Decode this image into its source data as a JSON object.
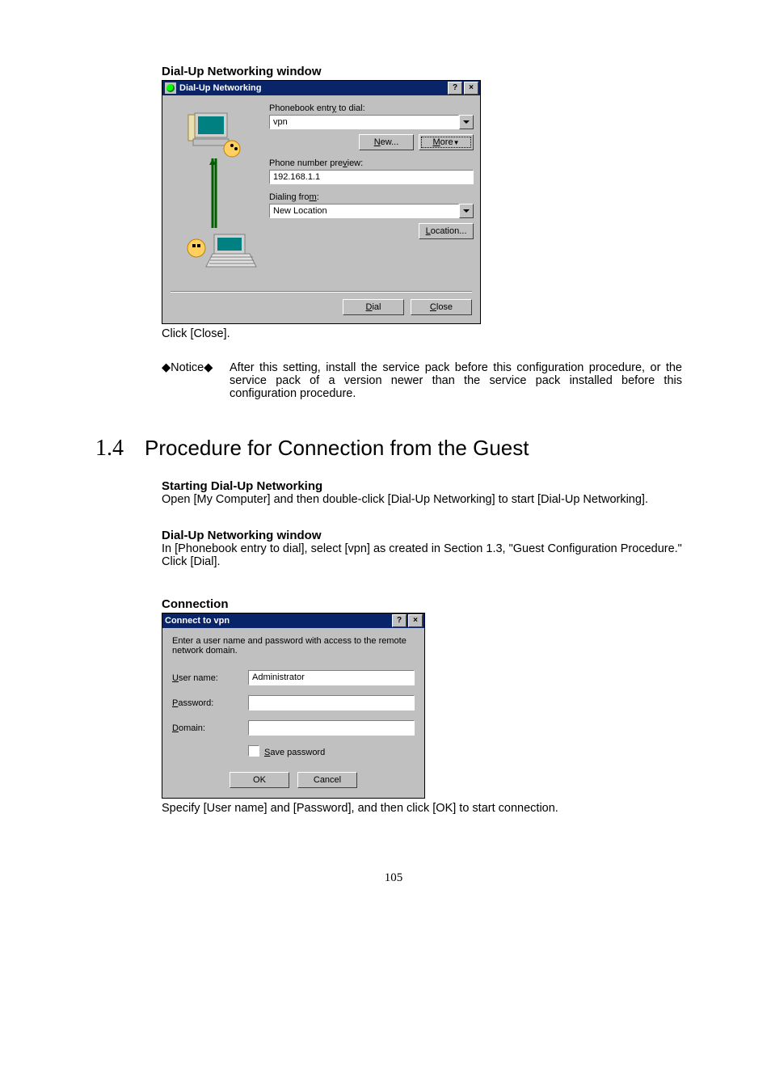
{
  "section1": {
    "caption": "Dial-Up Networking window",
    "dialog": {
      "title": "Dial-Up Networking",
      "help": "?",
      "close": "×",
      "phonebook_label_pre": "Phonebook entr",
      "phonebook_label_u": "y",
      "phonebook_label_post": " to dial:",
      "phonebook_value": "vpn",
      "new_label_u": "N",
      "new_label_post": "ew...",
      "more_label_u": "M",
      "more_label_post": "ore ",
      "preview_label_pre": "Phone number pre",
      "preview_label_u": "v",
      "preview_label_post": "iew:",
      "preview_value": "192.168.1.1",
      "from_label_pre": "Dialing fro",
      "from_label_u": "m",
      "from_label_post": ":",
      "from_value": "New Location",
      "location_label_u": "L",
      "location_label_post": "ocation...",
      "dial_label_u": "D",
      "dial_label_post": "ial",
      "close_label_u": "C",
      "close_label_post": "lose"
    },
    "after": "Click [Close].",
    "notice_label": "◆Notice◆",
    "notice_text": "After this setting, install the service pack before this configuration procedure, or the service pack of a version newer than the service pack installed before this configuration procedure."
  },
  "section_heading": {
    "num": "1.4",
    "title": "Procedure for Connection from the Guest"
  },
  "start": {
    "heading": "Starting Dial-Up Networking",
    "text": "Open [My Computer] and then double-click [Dial-Up Networking] to start [Dial-Up Networking]."
  },
  "dunwin": {
    "heading": "Dial-Up Networking window",
    "text": "In [Phonebook entry to dial], select [vpn] as created in Section 1.3, \"Guest Configuration Procedure.\"",
    "text2": "Click [Dial]."
  },
  "conn": {
    "caption": "Connection",
    "dialog": {
      "title": "Connect to vpn",
      "help": "?",
      "close": "×",
      "instruction": "Enter a user name and password with access to the remote network domain.",
      "user_label_u": "U",
      "user_label_post": "ser name:",
      "user_value": "Administrator",
      "pass_label_u": "P",
      "pass_label_post": "assword:",
      "pass_value": "",
      "domain_label_u": "D",
      "domain_label_post": "omain:",
      "domain_value": "",
      "save_label_u": "S",
      "save_label_post": "ave password",
      "ok": "OK",
      "cancel": "Cancel"
    },
    "after": "Specify [User name] and [Password], and then click [OK] to start connection."
  },
  "page_number": "105"
}
